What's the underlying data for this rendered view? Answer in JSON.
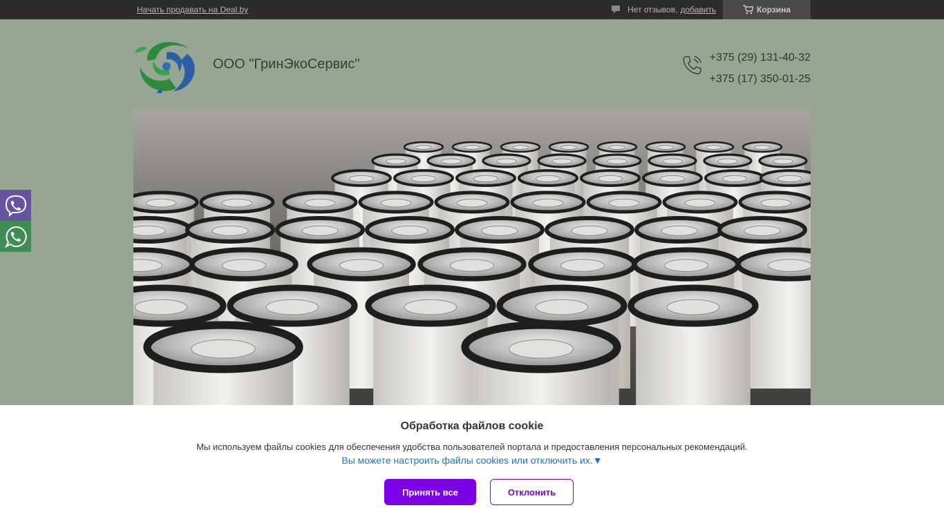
{
  "topbar": {
    "sell_link": "Начать продавать на Deal.by",
    "reviews_text": "Нет отзывов,",
    "reviews_add": "добавить",
    "cart_label": "Корзина"
  },
  "header": {
    "company_name": "ООО \"ГринЭкоСервис\"",
    "phones": [
      "+375 (29) 131-40-32",
      "+375 (17) 350-01-25"
    ]
  },
  "hero": {
    "image": "industrial-filter-cartridges-photo"
  },
  "messengers": {
    "viber_icon": "viber-icon",
    "whatsapp_icon": "whatsapp-icon",
    "viber_color": "#6654a0",
    "whatsapp_color": "#3f8c55"
  },
  "cookie": {
    "title": "Обработка файлов cookie",
    "text": "Мы используем файлы cookies для обеспечения удобства пользователей портала и предоставления персональных рекомендаций.",
    "configure": "Вы можете настроить файлы cookies или отключить их.",
    "configure_arrow": "▼",
    "accept_label": "Принять все",
    "decline_label": "Отклонить",
    "accent_color": "#7b00e6"
  }
}
